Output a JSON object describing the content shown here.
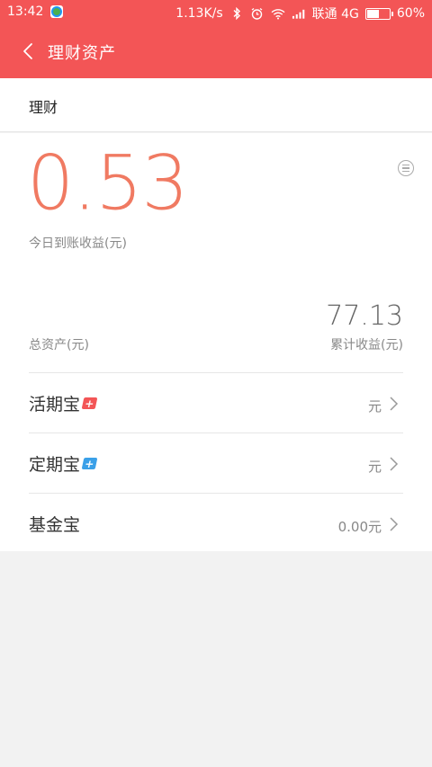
{
  "status_bar": {
    "time": "13:42",
    "net_speed": "1.13K/s",
    "carrier": "联通 4G",
    "battery": "60%",
    "battery_level": 0.6
  },
  "header": {
    "title": "理财资产"
  },
  "section": {
    "title": "理财"
  },
  "summary": {
    "today_income": "0.53",
    "today_label": "今日到账收益(元)",
    "cumulative_income": "77.13",
    "total_assets_label": "总资产(元)",
    "cumulative_label": "累计收益(元)"
  },
  "products": [
    {
      "name": "活期宝",
      "badge": "+",
      "badge_color": "#f35556",
      "value": "元"
    },
    {
      "name": "定期宝",
      "badge": "+",
      "badge_color": "#3aa0e8",
      "value": "元"
    },
    {
      "name": "基金宝",
      "badge": "",
      "badge_color": "",
      "value": "0.00元"
    }
  ],
  "colors": {
    "header_bg": "#f35556",
    "accent_number": "#f07a62"
  }
}
